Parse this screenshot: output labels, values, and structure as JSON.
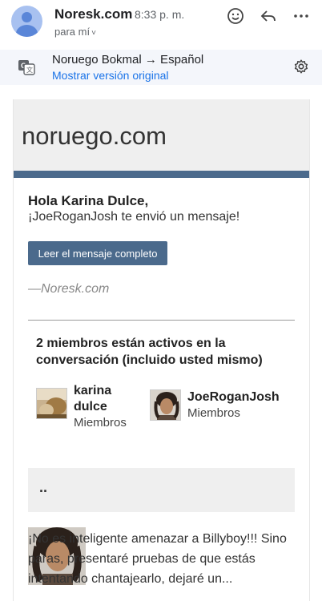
{
  "header": {
    "sender": "Noresk.com",
    "time": "8:33 p. m.",
    "recipient": "para mí",
    "chevron": "˅"
  },
  "translate_bar": {
    "languages": "Noruego Bokmal → Español",
    "show_original": "Mostrar versión original"
  },
  "email": {
    "brand": "noruego.com",
    "greeting": "Hola Karina Dulce,",
    "message": "¡JoeRoganJosh te envió un mensaje!",
    "cta_label": "Leer el mensaje completo",
    "signature": "—Noresk.com",
    "members_title": "2 miembros están activos en la conversación (incluido usted mismo)",
    "members": [
      {
        "name_line1": "karina",
        "name_line2": "dulce",
        "role": "Miembros"
      },
      {
        "name": "JoeRoganJosh",
        "role": "Miembros"
      }
    ],
    "snippet_dots": "..",
    "preview": "¡No es inteligente amenazar a Billyboy!!! Sino paras, presentaré pruebas de que estás intentando chantajearlo, dejaré un..."
  },
  "colors": {
    "accent": "#4b6a8c",
    "link": "#1a73e8",
    "avatar": "#5a86d8"
  },
  "icons": [
    "avatar-icon",
    "emoji-icon",
    "reply-icon",
    "more-icon",
    "translate-icon",
    "gear-icon"
  ]
}
